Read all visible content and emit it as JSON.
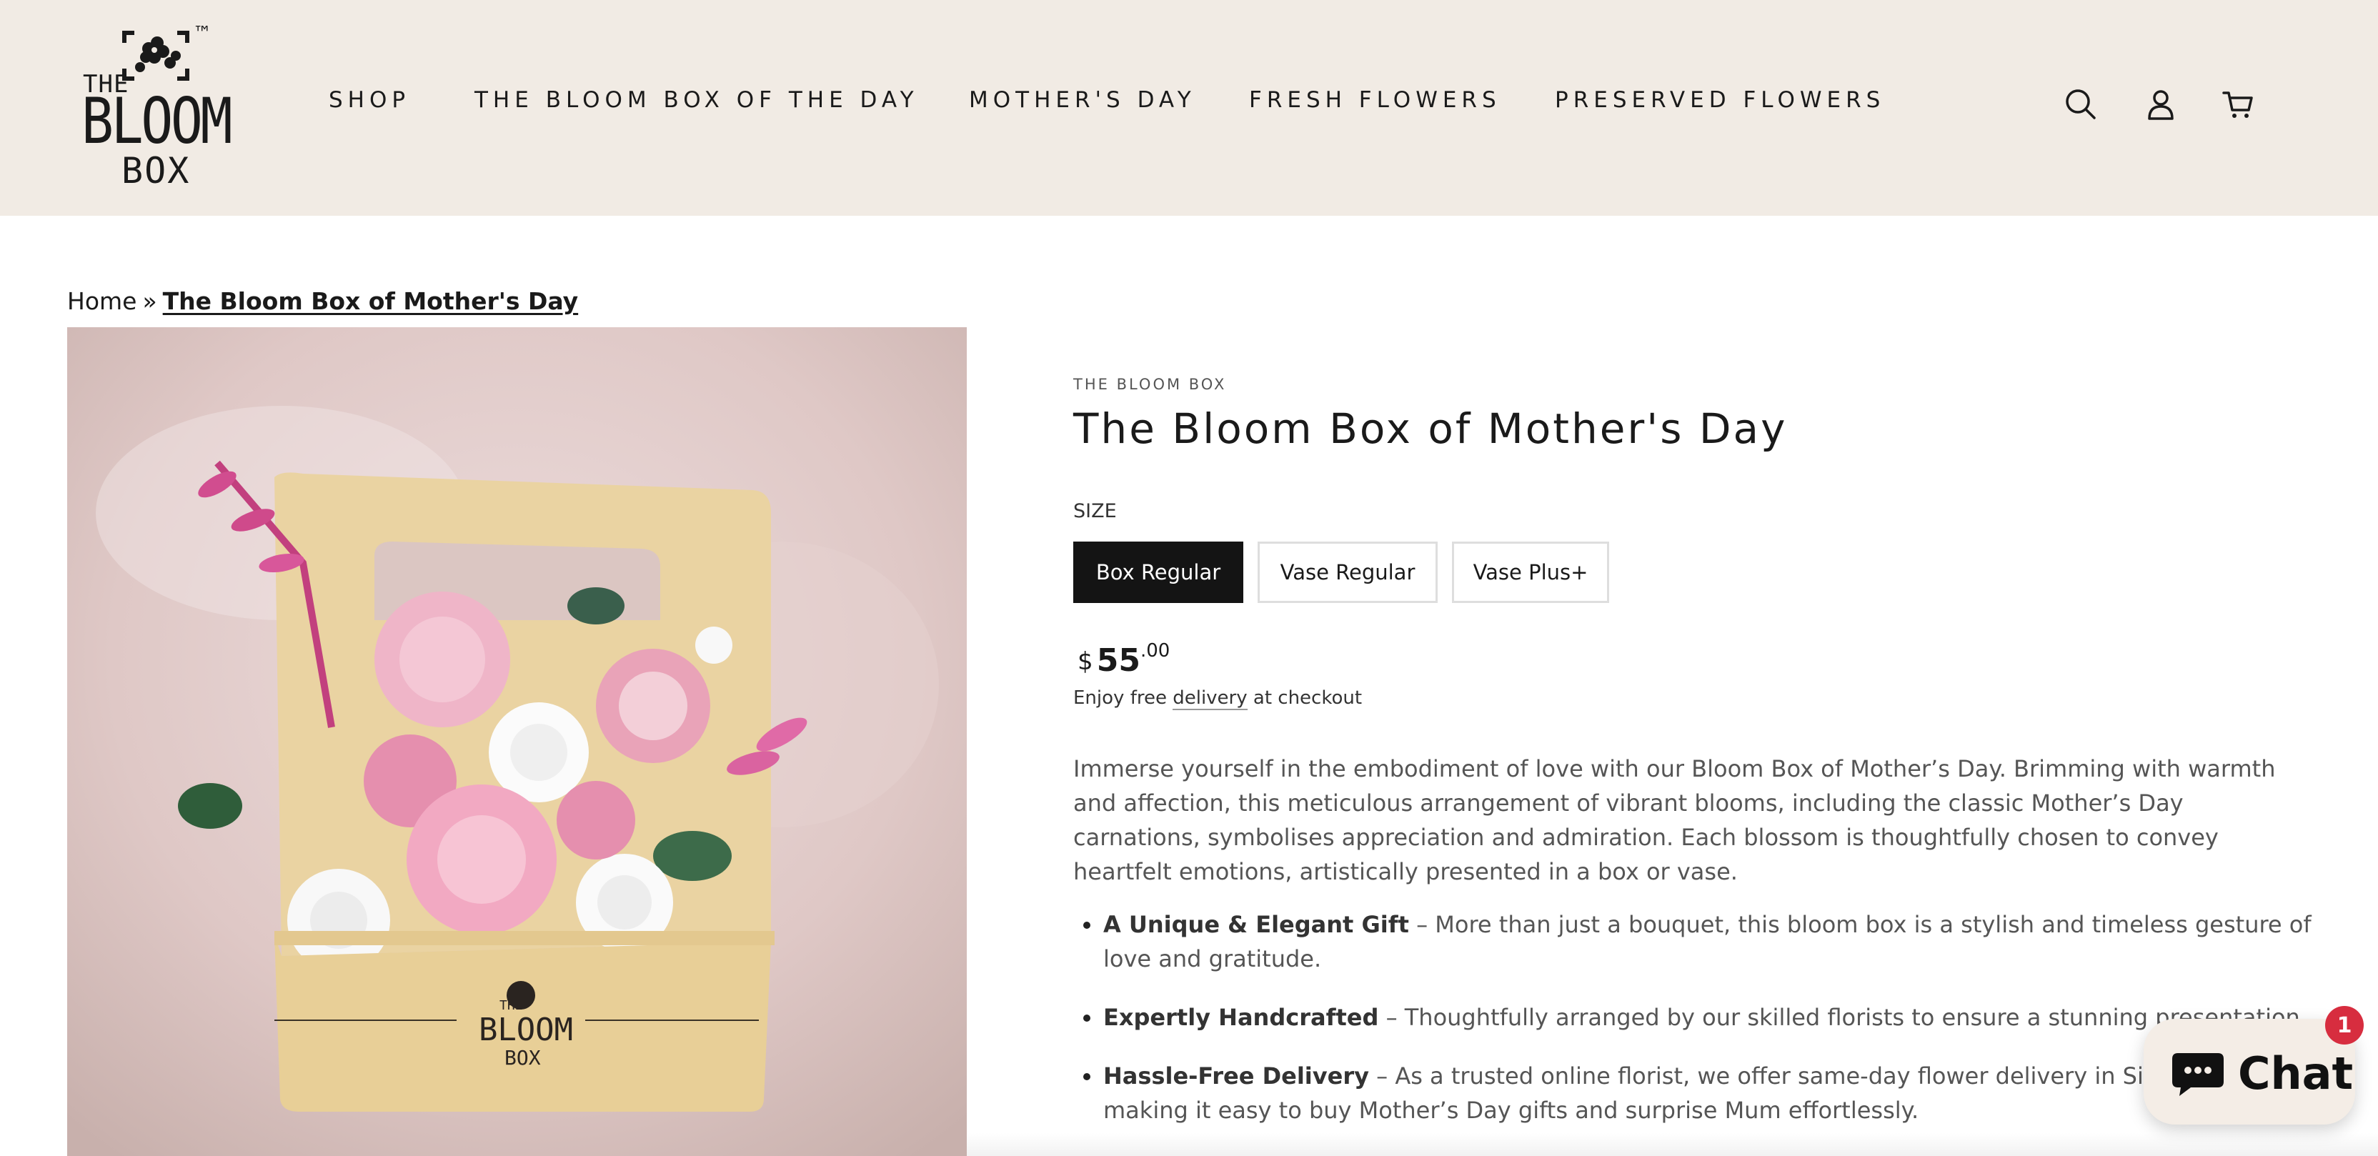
{
  "header": {
    "logo": {
      "tm": "™",
      "line1": "THE",
      "line2": "BLOOM",
      "line3": "BOX"
    },
    "nav": [
      {
        "label": "SHOP"
      },
      {
        "label": "THE BLOOM BOX OF THE DAY"
      },
      {
        "label": "MOTHER'S DAY"
      },
      {
        "label": "FRESH FLOWERS"
      },
      {
        "label": "PRESERVED FLOWERS"
      }
    ],
    "icons": [
      "search-icon",
      "account-icon",
      "cart-icon"
    ]
  },
  "breadcrumb": {
    "home": "Home",
    "separator": "»",
    "current": "The Bloom Box of Mother's Day"
  },
  "product": {
    "vendor": "THE BLOOM BOX",
    "title": "The Bloom Box of Mother's Day",
    "size_label": "SIZE",
    "variants": [
      {
        "label": "Box Regular",
        "selected": true
      },
      {
        "label": "Vase Regular",
        "selected": false
      },
      {
        "label": "Vase Plus+",
        "selected": false
      }
    ],
    "price": {
      "currency": "$",
      "integer": "55",
      "decimal": ".00"
    },
    "delivery": {
      "before": "Enjoy free ",
      "link": "delivery",
      "after": " at checkout"
    },
    "description": "Immerse yourself in the embodiment of love with our Bloom Box of Mother’s Day. Brimming with warmth and affection, this meticulous arrangement of vibrant blooms, including the classic Mother’s Day carnations, symbolises appreciation and admiration. Each blossom is thoughtfully chosen to convey heartfelt emotions, artistically presented in a box or vase.",
    "bullets": [
      {
        "title": "A Unique & Elegant Gift",
        "text": " – More than just a bouquet, this bloom box is a stylish and timeless gesture of love and gratitude."
      },
      {
        "title": "Expertly Handcrafted",
        "text": " – Thoughtfully arranged by our skilled florists to ensure a stunning presentation."
      },
      {
        "title": "Hassle-Free Delivery",
        "text": " – As a trusted online florist, we offer same-day flower delivery in Singapore, making it easy to buy Mother’s Day gifts and surprise Mum effortlessly."
      }
    ],
    "image": {
      "box_logo_line1": "THE",
      "box_logo_line2": "BLOOM",
      "box_logo_line3": "BOX"
    }
  },
  "chat": {
    "label": "Chat",
    "badge": "1"
  },
  "colors": {
    "header_bg": "#f1ebe4",
    "selected_variant": "#141414",
    "badge": "#d72d3f",
    "chat_bg": "#f4ede6"
  }
}
